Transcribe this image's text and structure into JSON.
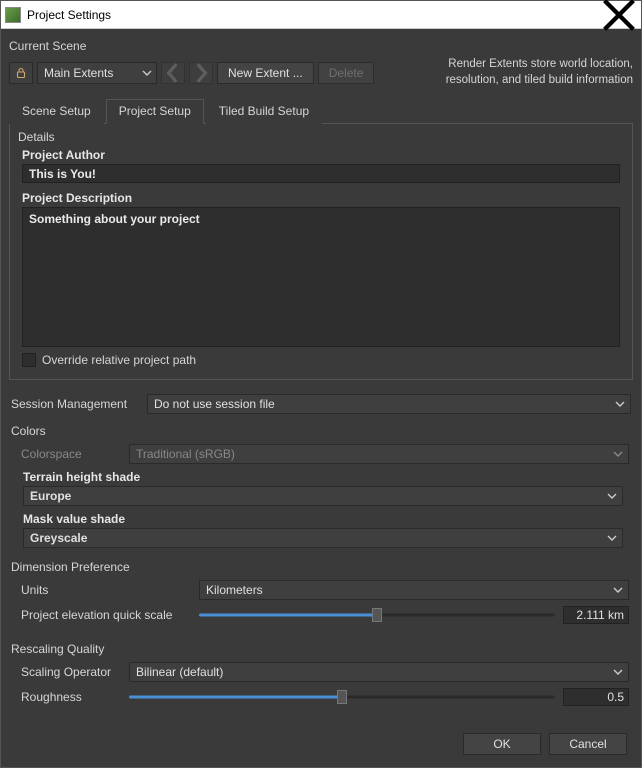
{
  "window": {
    "title": "Project Settings"
  },
  "currentScene": {
    "label": "Current Scene",
    "extentSelected": "Main Extents",
    "newExtentBtn": "New Extent ...",
    "deleteBtn": "Delete",
    "hintLine1": "Render Extents store world location,",
    "hintLine2": "resolution, and tiled build information"
  },
  "tabs": {
    "sceneSetup": "Scene Setup",
    "projectSetup": "Project Setup",
    "tiledBuildSetup": "Tiled Build Setup"
  },
  "details": {
    "title": "Details",
    "authorLabel": "Project Author",
    "authorValue": "This is You!",
    "descLabel": "Project Description",
    "descValue": "Something about your project",
    "overrideLabel": "Override relative project path"
  },
  "session": {
    "label": "Session Management",
    "value": "Do not use session file"
  },
  "colors": {
    "title": "Colors",
    "colorspaceLabel": "Colorspace",
    "colorspaceValue": "Traditional (sRGB)",
    "terrainLabel": "Terrain height shade",
    "terrainValue": "Europe",
    "maskLabel": "Mask value shade",
    "maskValue": "Greyscale"
  },
  "dimension": {
    "title": "Dimension Preference",
    "unitsLabel": "Units",
    "unitsValue": "Kilometers",
    "elevLabel": "Project elevation quick scale",
    "elevPercent": 50,
    "elevDisplay": "2.111 km"
  },
  "rescaling": {
    "title": "Rescaling Quality",
    "opLabel": "Scaling Operator",
    "opValue": "Bilinear (default)",
    "roughLabel": "Roughness",
    "roughPercent": 50,
    "roughDisplay": "0.5"
  },
  "footer": {
    "ok": "OK",
    "cancel": "Cancel"
  }
}
